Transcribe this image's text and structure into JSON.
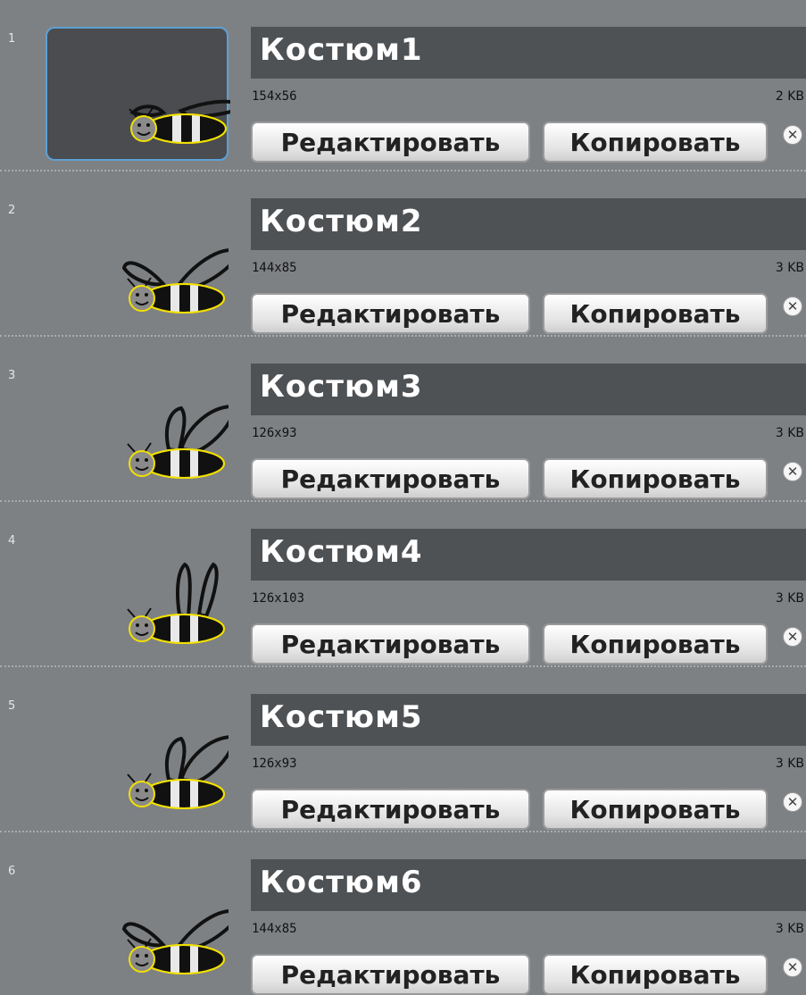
{
  "costumes": [
    {
      "number": "1",
      "name": "Костюм1",
      "size": "154x56",
      "file_size": "2 KB",
      "edit_label": "Редактировать",
      "copy_label": "Копировать",
      "selected": true,
      "wing_pose": "flat"
    },
    {
      "number": "2",
      "name": "Костюм2",
      "size": "144x85",
      "file_size": "3 KB",
      "edit_label": "Редактировать",
      "copy_label": "Копировать",
      "selected": false,
      "wing_pose": "low"
    },
    {
      "number": "3",
      "name": "Костюм3",
      "size": "126x93",
      "file_size": "3 KB",
      "edit_label": "Редактировать",
      "copy_label": "Копировать",
      "selected": false,
      "wing_pose": "mid"
    },
    {
      "number": "4",
      "name": "Костюм4",
      "size": "126x103",
      "file_size": "3 KB",
      "edit_label": "Редактировать",
      "copy_label": "Копировать",
      "selected": false,
      "wing_pose": "up"
    },
    {
      "number": "5",
      "name": "Костюм5",
      "size": "126x93",
      "file_size": "3 KB",
      "edit_label": "Редактировать",
      "copy_label": "Копировать",
      "selected": false,
      "wing_pose": "mid"
    },
    {
      "number": "6",
      "name": "Костюм6",
      "size": "144x85",
      "file_size": "3 KB",
      "edit_label": "Редактировать",
      "copy_label": "Копировать",
      "selected": false,
      "wing_pose": "low"
    }
  ],
  "delete_icon": "close-circle-icon",
  "colors": {
    "selection_border": "#5da0d6",
    "bee_outline": "#f2e000",
    "panel_bg": "#7e8184"
  }
}
